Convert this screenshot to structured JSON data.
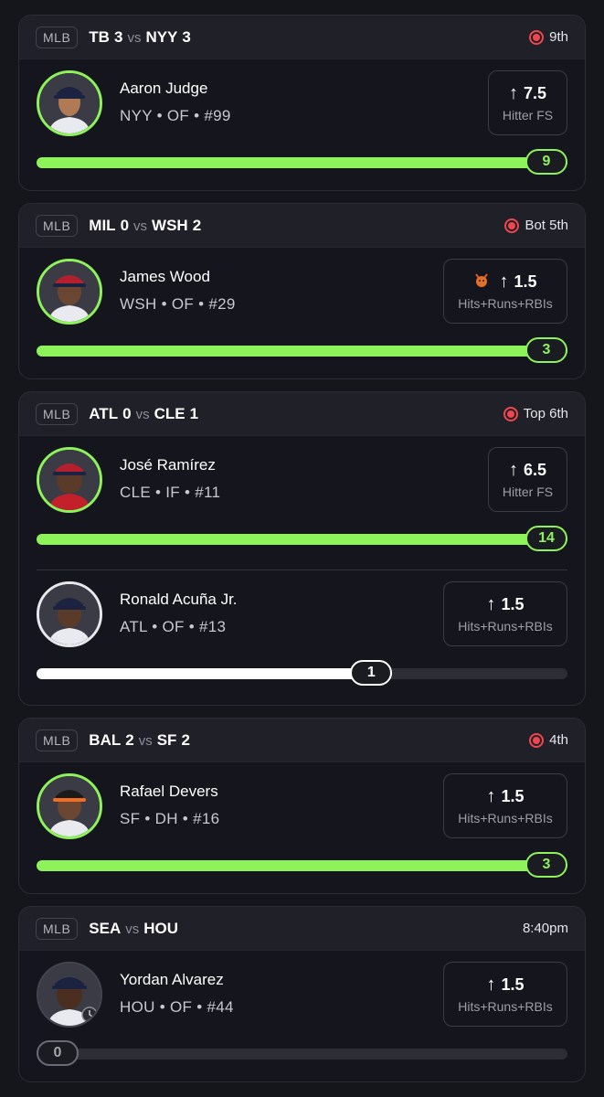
{
  "cards": [
    {
      "league": "MLB",
      "away_team": "TB",
      "away_score": "3",
      "vs": "vs",
      "home_team": "NYY",
      "home_score": "3",
      "status": "9th",
      "live": true,
      "players": [
        {
          "name": "Aaron Judge",
          "meta": "NYY • OF • #99",
          "line": "7.5",
          "stat": "Hitter FS",
          "current": "9",
          "progress": 1.0
        }
      ]
    },
    {
      "league": "MLB",
      "away_team": "MIL",
      "away_score": "0",
      "vs": "vs",
      "home_team": "WSH",
      "home_score": "2",
      "status": "Bot 5th",
      "live": true,
      "players": [
        {
          "name": "James Wood",
          "meta": "WSH • OF • #29",
          "line": "1.5",
          "stat": "Hits+Runs+RBIs",
          "current": "3",
          "progress": 1.0,
          "badge_icon": "devil-icon"
        }
      ]
    },
    {
      "league": "MLB",
      "away_team": "ATL",
      "away_score": "0",
      "vs": "vs",
      "home_team": "CLE",
      "home_score": "1",
      "status": "Top 6th",
      "live": true,
      "players": [
        {
          "name": "José Ramírez",
          "meta": "CLE • IF • #11",
          "line": "6.5",
          "stat": "Hitter FS",
          "current": "14",
          "progress": 1.0
        },
        {
          "name": "Ronald Acuña Jr.",
          "meta": "ATL • OF • #13",
          "line": "1.5",
          "stat": "Hits+Runs+RBIs",
          "current": "1",
          "progress": 0.67
        }
      ]
    },
    {
      "league": "MLB",
      "away_team": "BAL",
      "away_score": "2",
      "vs": "vs",
      "home_team": "SF",
      "home_score": "2",
      "status": "4th",
      "live": true,
      "players": [
        {
          "name": "Rafael Devers",
          "meta": "SF • DH • #16",
          "line": "1.5",
          "stat": "Hits+Runs+RBIs",
          "current": "3",
          "progress": 1.0
        }
      ]
    },
    {
      "league": "MLB",
      "away_team": "SEA",
      "away_score": "",
      "vs": "vs",
      "home_team": "HOU",
      "home_score": "",
      "status": "8:40pm",
      "live": false,
      "players": [
        {
          "name": "Yordan Alvarez",
          "meta": "HOU • OF • #44",
          "line": "1.5",
          "stat": "Hits+Runs+RBIs",
          "current": "0",
          "progress": 0.0
        }
      ]
    }
  ],
  "colors": {
    "accent_green": "#8ef25a",
    "live_red": "#f0474f",
    "background": "#15151c"
  },
  "icons": {
    "up_arrow": "arrow-up-icon",
    "live": "live-indicator-icon",
    "avatar": "player-headshot-icon"
  }
}
